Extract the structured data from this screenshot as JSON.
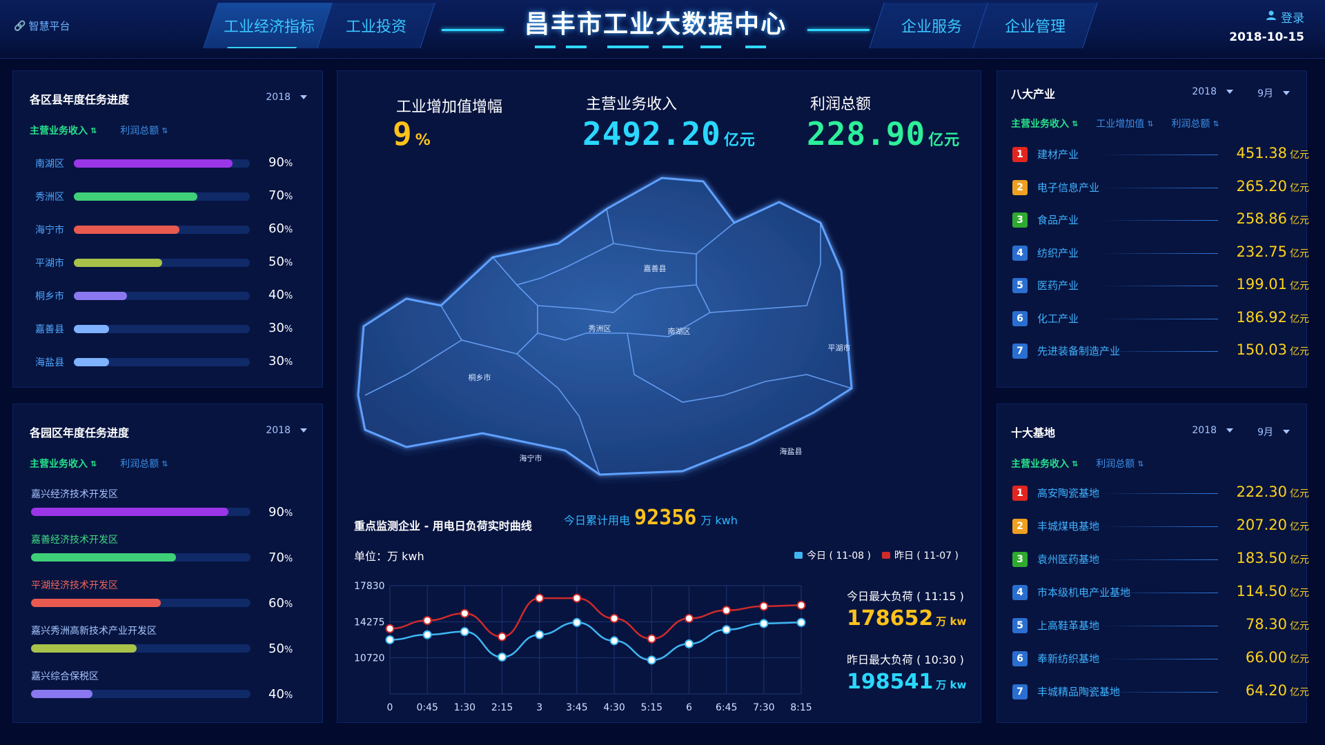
{
  "header": {
    "platform": "智慧平台",
    "nav_left": [
      "工业经济指标",
      "工业投资"
    ],
    "title": "昌丰市工业大数据中心",
    "nav_right": [
      "企业服务",
      "企业管理"
    ],
    "login": "登录",
    "date": "2018-10-15"
  },
  "district_panel": {
    "title": "各区县年度任务进度",
    "year": "2018",
    "tabs": [
      "主营业务收入",
      "利润总额"
    ],
    "items": [
      {
        "name": "南湖区",
        "pct": "90",
        "fill": 0.9,
        "color": "#9b36e8"
      },
      {
        "name": "秀洲区",
        "pct": "70",
        "fill": 0.7,
        "color": "#3fcf78"
      },
      {
        "name": "海宁市",
        "pct": "60",
        "fill": 0.6,
        "color": "#e85a4f"
      },
      {
        "name": "平湖市",
        "pct": "50",
        "fill": 0.5,
        "color": "#a8c24a"
      },
      {
        "name": "桐乡市",
        "pct": "40",
        "fill": 0.3,
        "color": "#8a78f0"
      },
      {
        "name": "嘉善县",
        "pct": "30",
        "fill": 0.2,
        "color": "#7fb2ff"
      },
      {
        "name": "海盐县",
        "pct": "30",
        "fill": 0.2,
        "color": "#7fb2ff"
      }
    ]
  },
  "park_panel": {
    "title": "各园区年度任务进度",
    "year": "2018",
    "tabs": [
      "主营业务收入",
      "利润总额"
    ],
    "items": [
      {
        "name": "嘉兴经济技术开发区",
        "pct": "90",
        "fill": 0.9,
        "color": "#9b36e8"
      },
      {
        "name": "嘉善经济技术开发区",
        "pct": "70",
        "fill": 0.66,
        "color": "#3fcf78"
      },
      {
        "name": "平湖经济技术开发区",
        "pct": "60",
        "fill": 0.59,
        "color": "#e85a4f"
      },
      {
        "name": "嘉兴秀洲高新技术产业开发区",
        "pct": "50",
        "fill": 0.48,
        "color": "#a8c24a"
      },
      {
        "name": "嘉兴综合保税区",
        "pct": "40",
        "fill": 0.28,
        "color": "#8a78f0"
      }
    ]
  },
  "kpis": [
    {
      "label": "工业增加值增幅",
      "value": "9",
      "unit": "%",
      "color": "#ffc21a"
    },
    {
      "label": "主营业务收入",
      "value": "2492.20",
      "unit": "亿元",
      "color": "#2ad8ff"
    },
    {
      "label": "利润总额",
      "value": "228.90",
      "unit": "亿元",
      "color": "#2df09a"
    }
  ],
  "map": {
    "regions": [
      "嘉善县",
      "秀洲区",
      "南湖区",
      "平湖市",
      "桐乡市",
      "海宁市",
      "海盐县"
    ]
  },
  "monitor": {
    "title": "重点监测企业 - 用电日负荷实时曲线",
    "today_label": "今日累计用电",
    "today_value": "92356",
    "today_unit": "万 kwh",
    "unit_line": "单位：万 kwh",
    "legend_today": "今日 ( 11-08 )",
    "legend_yesterday": "昨日 ( 11-07 )",
    "today_max_label": "今日最大负荷 ( 11:15 )",
    "today_max_value": "178652",
    "yesterday_max_label": "昨日最大负荷 ( 10:30 )",
    "yesterday_max_value": "198541",
    "max_unit": "万 kw"
  },
  "chart_data": {
    "type": "line",
    "x": [
      "0",
      "0:45",
      "1:30",
      "2:15",
      "3",
      "3:45",
      "4:30",
      "5:15",
      "6",
      "6:45",
      "7:30",
      "8:15"
    ],
    "yticks": [
      "17830",
      "14275",
      "10720"
    ],
    "ylim": [
      7165,
      17830
    ],
    "grid": true,
    "series": [
      {
        "name": "今日 ( 11-08 )",
        "color": "#3fb6f0",
        "values": [
          12500,
          13000,
          13300,
          10800,
          13000,
          14200,
          12400,
          10500,
          12100,
          13500,
          14100,
          14200
        ]
      },
      {
        "name": "昨日 ( 11-07 )",
        "color": "#d02a2a",
        "values": [
          13600,
          14400,
          15100,
          12800,
          16600,
          16600,
          14600,
          12600,
          14600,
          15400,
          15800,
          15900
        ]
      }
    ]
  },
  "industry_panel": {
    "title": "八大产业",
    "year": "2018",
    "month": "9月",
    "tabs": [
      "主营业务收入",
      "工业增加值",
      "利润总额"
    ],
    "unit": "亿元",
    "items": [
      {
        "rank": "1",
        "name": "建材产业",
        "value": "451.38",
        "color": "#e2261f"
      },
      {
        "rank": "2",
        "name": "电子信息产业",
        "value": "265.20",
        "color": "#f0a020"
      },
      {
        "rank": "3",
        "name": "食品产业",
        "value": "258.86",
        "color": "#2faa2f"
      },
      {
        "rank": "4",
        "name": "纺织产业",
        "value": "232.75",
        "color": "#2a6fd0"
      },
      {
        "rank": "5",
        "name": "医药产业",
        "value": "199.01",
        "color": "#2a6fd0"
      },
      {
        "rank": "6",
        "name": "化工产业",
        "value": "186.92",
        "color": "#2a6fd0"
      },
      {
        "rank": "7",
        "name": "先进装备制造产业",
        "value": "150.03",
        "color": "#2a6fd0"
      }
    ]
  },
  "base_panel": {
    "title": "十大基地",
    "year": "2018",
    "month": "9月",
    "tabs": [
      "主营业务收入",
      "利润总额"
    ],
    "unit": "亿元",
    "items": [
      {
        "rank": "1",
        "name": "高安陶瓷基地",
        "value": "222.30",
        "color": "#e2261f"
      },
      {
        "rank": "2",
        "name": "丰城煤电基地",
        "value": "207.20",
        "color": "#f0a020"
      },
      {
        "rank": "3",
        "name": "袁州医药基地",
        "value": "183.50",
        "color": "#2faa2f"
      },
      {
        "rank": "4",
        "name": "市本级机电产业基地",
        "value": "114.50",
        "color": "#2a6fd0"
      },
      {
        "rank": "5",
        "name": "上高鞋革基地",
        "value": "78.30",
        "color": "#2a6fd0"
      },
      {
        "rank": "6",
        "name": "奉新纺织基地",
        "value": "66.00",
        "color": "#2a6fd0"
      },
      {
        "rank": "7",
        "name": "丰城精品陶瓷基地",
        "value": "64.20",
        "color": "#2a6fd0"
      }
    ]
  }
}
